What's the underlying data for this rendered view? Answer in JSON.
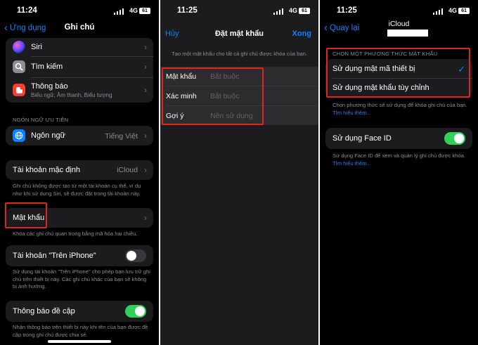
{
  "panel1": {
    "status": {
      "time": "11:24",
      "network": "4G",
      "battery": "61"
    },
    "nav": {
      "back_label": "Ứng dụng",
      "title": "Ghi chú"
    },
    "top_group": [
      {
        "label": "Siri",
        "icon": "siri-icon"
      },
      {
        "label": "Tìm kiếm",
        "icon": "search-icon"
      },
      {
        "label": "Thông báo",
        "sublabel": "Biểu ngữ, Âm thanh, Biểu tượng",
        "icon": "notification-icon"
      }
    ],
    "language_section_header": "NGÔN NGỮ ƯU TIÊN",
    "language": {
      "label": "Ngôn ngữ",
      "value": "Tiếng Việt",
      "icon": "globe-icon"
    },
    "default_account": {
      "label": "Tài khoản mặc định",
      "value": "iCloud"
    },
    "default_account_note": "Ghi chú không được tạo từ một tài khoản cụ thể, ví dụ như khi sử dụng Siri, sẽ được đặt trong tài khoản này.",
    "password": {
      "label": "Mật khẩu"
    },
    "password_note": "Khóa các ghi chú quan trọng bằng mã hóa hai chiều.",
    "on_iphone": {
      "label": "Tài khoản \"Trên iPhone\"",
      "enabled": false
    },
    "on_iphone_note": "Sử dụng tài khoản \"Trên iPhone\" cho phép bạn lưu trữ ghi chú trên thiết bị này. Các ghi chú khác của bạn sẽ không bị ảnh hưởng.",
    "mentions": {
      "label": "Thông báo đề cập",
      "enabled": true
    },
    "mentions_note": "Nhận thông báo trên thiết bị này khi tên của bạn được đề cập trong ghi chú được chia sẻ."
  },
  "panel2": {
    "status": {
      "time": "11:25",
      "network": "4G",
      "battery": "61"
    },
    "cancel_label": "Hủy",
    "title": "Đặt mật khẩu",
    "done_label": "Xong",
    "description": "Tạo một mật khẩu cho tất cả ghi chú được khóa của bạn.",
    "fields": [
      {
        "label": "Mật khẩu",
        "placeholder": "Bắt buộc"
      },
      {
        "label": "Xác minh",
        "placeholder": "Bắt buộc"
      },
      {
        "label": "Gợi ý",
        "placeholder": "Nên sử dụng"
      }
    ]
  },
  "panel3": {
    "status": {
      "time": "11:25",
      "network": "4G",
      "battery": "61"
    },
    "nav": {
      "back_label": "Quay lại",
      "title": "iCloud"
    },
    "section_header": "CHỌN MỘT PHƯƠNG THỨC MẬT KHẨU",
    "options": [
      {
        "label": "Sử dụng mật mã thiết bị",
        "selected": true
      },
      {
        "label": "Sử dụng mật khẩu tùy chỉnh",
        "selected": false
      }
    ],
    "method_note": "Chọn phương thức sẽ sử dụng để khóa ghi chú của bạn.",
    "learn_more": "Tìm hiểu thêm...",
    "face_id": {
      "label": "Sử dụng Face ID",
      "enabled": true
    },
    "face_id_note": "Sử dụng Face ID để xem và quản lý ghi chú được khóa.",
    "face_id_learn_more": "Tìm hiểu thêm..."
  },
  "colors": {
    "accent": "#0a84ff",
    "toggle_on": "#30d158",
    "highlight": "#e02424"
  }
}
